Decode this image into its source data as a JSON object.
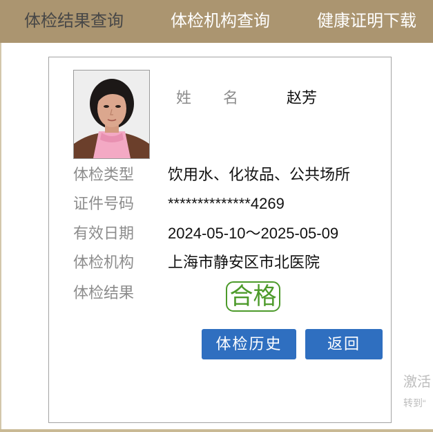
{
  "nav": {
    "tabs": [
      {
        "label": "体检结果查询",
        "active": true
      },
      {
        "label": "体检机构查询",
        "active": false
      },
      {
        "label": "健康证明下载",
        "active": false
      }
    ]
  },
  "profile": {
    "name_label": "姓名",
    "name": "赵芳"
  },
  "details": [
    {
      "label": "体检类型",
      "value": "饮用水、化妆品、公共场所"
    },
    {
      "label": "证件号码",
      "value": "**************4269"
    },
    {
      "label": "有效日期",
      "value": "2024-05-10～2025-05-09"
    },
    {
      "label": "体检机构",
      "value": "上海市静安区市北医院"
    }
  ],
  "result": {
    "label": "体检结果",
    "value": "合格"
  },
  "buttons": {
    "history": "体检历史",
    "back": "返回"
  },
  "watermark": {
    "line1": "激活",
    "line2": "转到“"
  },
  "colors": {
    "nav_bg": "#ab9570",
    "tab_active": "#474747",
    "label": "#8c8c8c",
    "pass": "#4c9a2a",
    "button": "#2f6fc0"
  }
}
